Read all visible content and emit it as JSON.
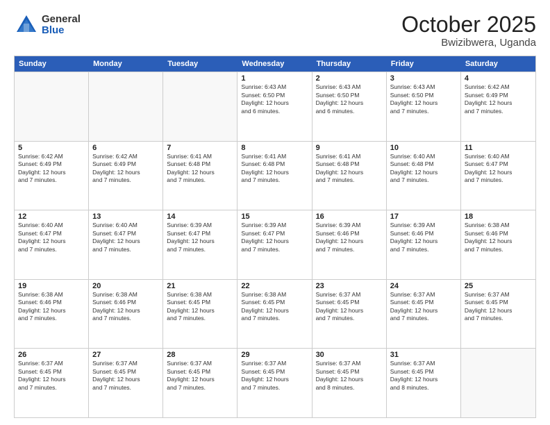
{
  "logo": {
    "general": "General",
    "blue": "Blue"
  },
  "header": {
    "month": "October 2025",
    "location": "Bwizibwera, Uganda"
  },
  "days": [
    "Sunday",
    "Monday",
    "Tuesday",
    "Wednesday",
    "Thursday",
    "Friday",
    "Saturday"
  ],
  "rows": [
    [
      {
        "day": "",
        "empty": true
      },
      {
        "day": "",
        "empty": true
      },
      {
        "day": "",
        "empty": true
      },
      {
        "day": "1",
        "sunrise": "6:43 AM",
        "sunset": "6:50 PM",
        "daylight": "12 hours and 6 minutes."
      },
      {
        "day": "2",
        "sunrise": "6:43 AM",
        "sunset": "6:50 PM",
        "daylight": "12 hours and 6 minutes."
      },
      {
        "day": "3",
        "sunrise": "6:43 AM",
        "sunset": "6:50 PM",
        "daylight": "12 hours and 7 minutes."
      },
      {
        "day": "4",
        "sunrise": "6:42 AM",
        "sunset": "6:49 PM",
        "daylight": "12 hours and 7 minutes."
      }
    ],
    [
      {
        "day": "5",
        "sunrise": "6:42 AM",
        "sunset": "6:49 PM",
        "daylight": "12 hours and 7 minutes."
      },
      {
        "day": "6",
        "sunrise": "6:42 AM",
        "sunset": "6:49 PM",
        "daylight": "12 hours and 7 minutes."
      },
      {
        "day": "7",
        "sunrise": "6:41 AM",
        "sunset": "6:48 PM",
        "daylight": "12 hours and 7 minutes."
      },
      {
        "day": "8",
        "sunrise": "6:41 AM",
        "sunset": "6:48 PM",
        "daylight": "12 hours and 7 minutes."
      },
      {
        "day": "9",
        "sunrise": "6:41 AM",
        "sunset": "6:48 PM",
        "daylight": "12 hours and 7 minutes."
      },
      {
        "day": "10",
        "sunrise": "6:40 AM",
        "sunset": "6:48 PM",
        "daylight": "12 hours and 7 minutes."
      },
      {
        "day": "11",
        "sunrise": "6:40 AM",
        "sunset": "6:47 PM",
        "daylight": "12 hours and 7 minutes."
      }
    ],
    [
      {
        "day": "12",
        "sunrise": "6:40 AM",
        "sunset": "6:47 PM",
        "daylight": "12 hours and 7 minutes."
      },
      {
        "day": "13",
        "sunrise": "6:40 AM",
        "sunset": "6:47 PM",
        "daylight": "12 hours and 7 minutes."
      },
      {
        "day": "14",
        "sunrise": "6:39 AM",
        "sunset": "6:47 PM",
        "daylight": "12 hours and 7 minutes."
      },
      {
        "day": "15",
        "sunrise": "6:39 AM",
        "sunset": "6:47 PM",
        "daylight": "12 hours and 7 minutes."
      },
      {
        "day": "16",
        "sunrise": "6:39 AM",
        "sunset": "6:46 PM",
        "daylight": "12 hours and 7 minutes."
      },
      {
        "day": "17",
        "sunrise": "6:39 AM",
        "sunset": "6:46 PM",
        "daylight": "12 hours and 7 minutes."
      },
      {
        "day": "18",
        "sunrise": "6:38 AM",
        "sunset": "6:46 PM",
        "daylight": "12 hours and 7 minutes."
      }
    ],
    [
      {
        "day": "19",
        "sunrise": "6:38 AM",
        "sunset": "6:46 PM",
        "daylight": "12 hours and 7 minutes."
      },
      {
        "day": "20",
        "sunrise": "6:38 AM",
        "sunset": "6:46 PM",
        "daylight": "12 hours and 7 minutes."
      },
      {
        "day": "21",
        "sunrise": "6:38 AM",
        "sunset": "6:45 PM",
        "daylight": "12 hours and 7 minutes."
      },
      {
        "day": "22",
        "sunrise": "6:38 AM",
        "sunset": "6:45 PM",
        "daylight": "12 hours and 7 minutes."
      },
      {
        "day": "23",
        "sunrise": "6:37 AM",
        "sunset": "6:45 PM",
        "daylight": "12 hours and 7 minutes."
      },
      {
        "day": "24",
        "sunrise": "6:37 AM",
        "sunset": "6:45 PM",
        "daylight": "12 hours and 7 minutes."
      },
      {
        "day": "25",
        "sunrise": "6:37 AM",
        "sunset": "6:45 PM",
        "daylight": "12 hours and 7 minutes."
      }
    ],
    [
      {
        "day": "26",
        "sunrise": "6:37 AM",
        "sunset": "6:45 PM",
        "daylight": "12 hours and 7 minutes."
      },
      {
        "day": "27",
        "sunrise": "6:37 AM",
        "sunset": "6:45 PM",
        "daylight": "12 hours and 7 minutes."
      },
      {
        "day": "28",
        "sunrise": "6:37 AM",
        "sunset": "6:45 PM",
        "daylight": "12 hours and 7 minutes."
      },
      {
        "day": "29",
        "sunrise": "6:37 AM",
        "sunset": "6:45 PM",
        "daylight": "12 hours and 7 minutes."
      },
      {
        "day": "30",
        "sunrise": "6:37 AM",
        "sunset": "6:45 PM",
        "daylight": "12 hours and 8 minutes."
      },
      {
        "day": "31",
        "sunrise": "6:37 AM",
        "sunset": "6:45 PM",
        "daylight": "12 hours and 8 minutes."
      },
      {
        "day": "",
        "empty": true
      }
    ]
  ],
  "labels": {
    "sunrise": "Sunrise:",
    "sunset": "Sunset:",
    "daylight": "Daylight:"
  }
}
